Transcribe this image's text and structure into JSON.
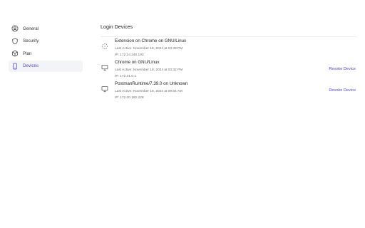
{
  "sidebar": {
    "items": [
      {
        "label": "General",
        "icon": "user-circle-icon",
        "active": false
      },
      {
        "label": "Security",
        "icon": "shield-icon",
        "active": false
      },
      {
        "label": "Plan",
        "icon": "box-icon",
        "active": false
      },
      {
        "label": "Devices",
        "icon": "phone-icon",
        "active": true
      }
    ]
  },
  "main": {
    "title": "Login Devices",
    "devices": [
      {
        "name": "Extension on Chrome on GNU/Linux",
        "last_active": "Last Active: November 18, 2024 at 03:39 PM",
        "ip": "IP: 172.24.240.193",
        "icon": "extension-icon",
        "revoke_label": ""
      },
      {
        "name": "Chrome on GNU/Linux",
        "last_active": "Last Active: November 18, 2024 at 03:32 PM",
        "ip": "IP: 172.31.0.1",
        "icon": "desktop-icon",
        "revoke_label": "Revoke Device"
      },
      {
        "name": "PostmanRuntime/7.39.0 on Unknown",
        "last_active": "Last Active: November 18, 2024 at 09:54 AM",
        "ip": "IP: 172.30.182.228",
        "icon": "desktop-icon",
        "revoke_label": "Revoke Device"
      }
    ]
  },
  "colors": {
    "accent": "#4a45c7",
    "active_bg": "#f3f4f7",
    "muted_text": "#6b6f76"
  }
}
